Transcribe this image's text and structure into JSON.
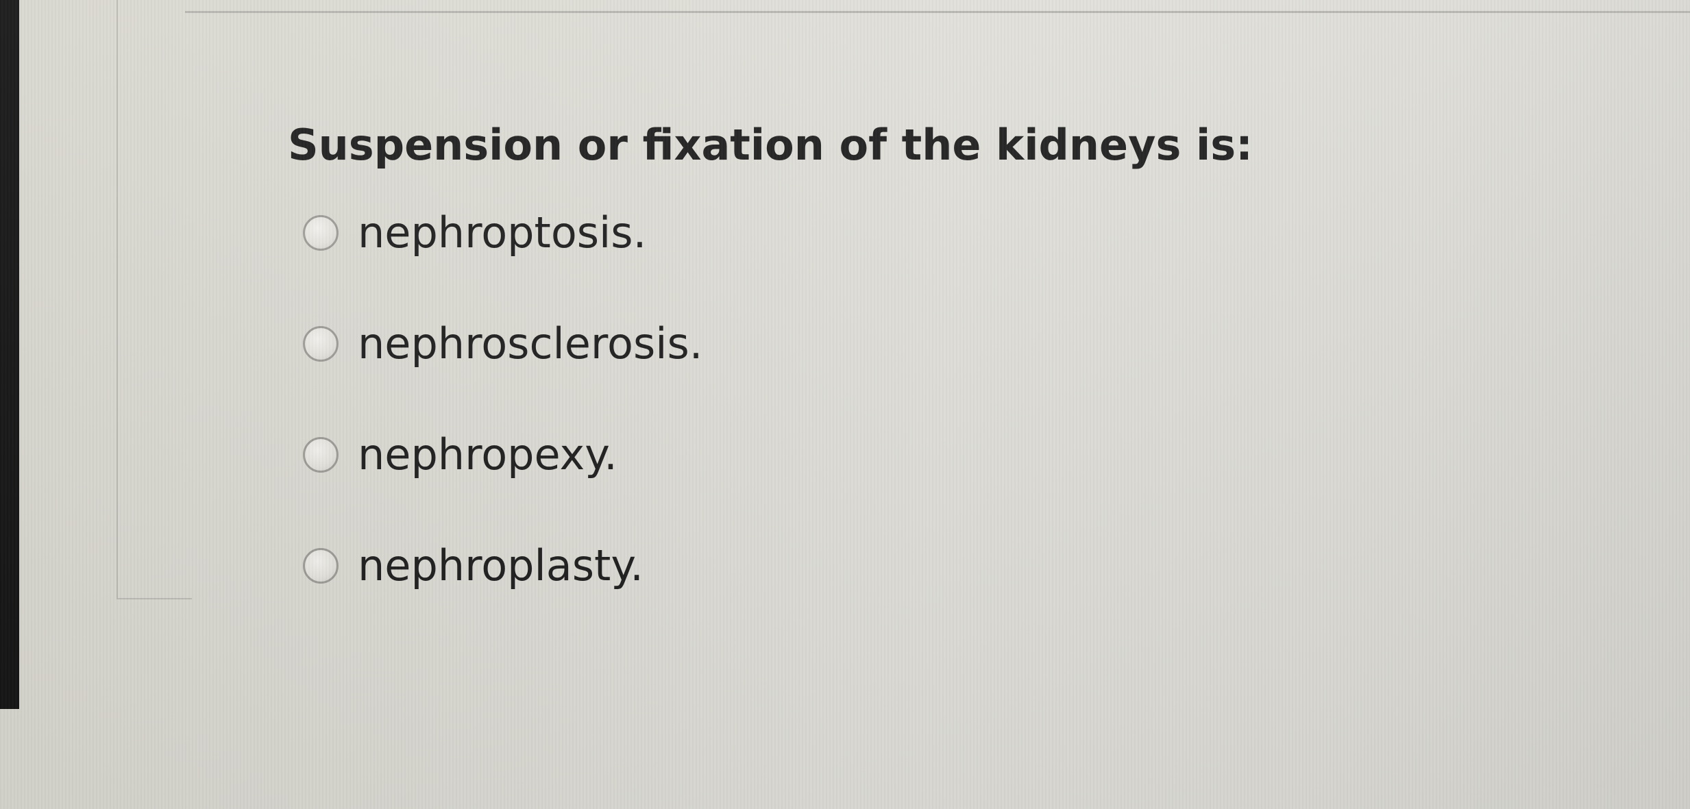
{
  "question": {
    "text": "Suspension or fixation of the kidneys is:",
    "options": [
      {
        "label": "nephroptosis."
      },
      {
        "label": "nephrosclerosis."
      },
      {
        "label": "nephropexy."
      },
      {
        "label": "nephroplasty."
      }
    ],
    "selected_index": null
  }
}
